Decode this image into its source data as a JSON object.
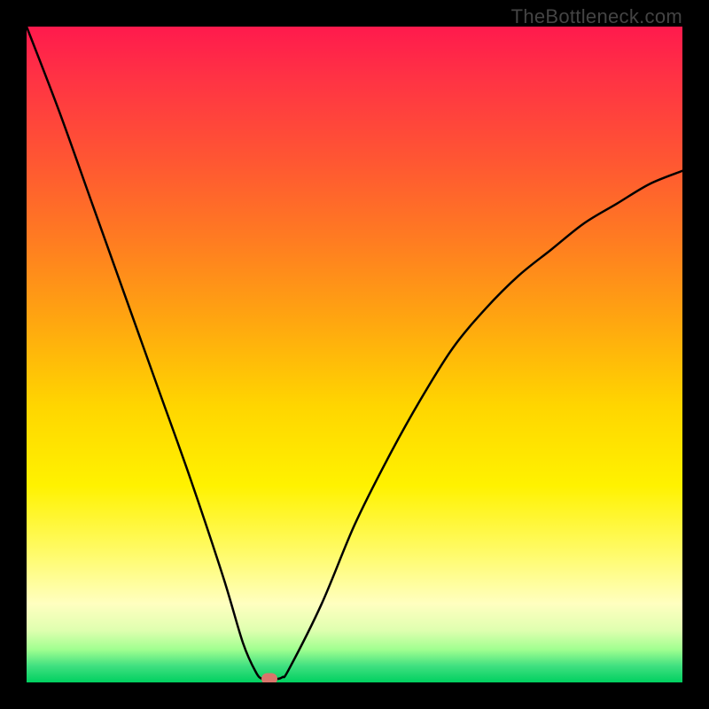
{
  "watermark": "TheBottleneck.com",
  "colors": {
    "frame_bg": "#000000",
    "dot": "#d9756b",
    "curve": "#000000"
  },
  "chart_data": {
    "type": "line",
    "title": "",
    "xlabel": "",
    "ylabel": "",
    "xlim": [
      0,
      100
    ],
    "ylim": [
      0,
      100
    ],
    "x": [
      0,
      5,
      10,
      15,
      20,
      25,
      30,
      33,
      35,
      36,
      37,
      38,
      39,
      40,
      45,
      50,
      55,
      60,
      65,
      70,
      75,
      80,
      85,
      90,
      95,
      100
    ],
    "values": [
      100,
      87,
      73,
      59,
      45,
      31,
      16,
      6,
      1.5,
      0.5,
      0.5,
      0.5,
      0.8,
      2,
      12,
      24,
      34,
      43,
      51,
      57,
      62,
      66,
      70,
      73,
      76,
      78
    ],
    "minimum_marker": {
      "x": 37,
      "y": 0.5
    },
    "annotations": []
  }
}
